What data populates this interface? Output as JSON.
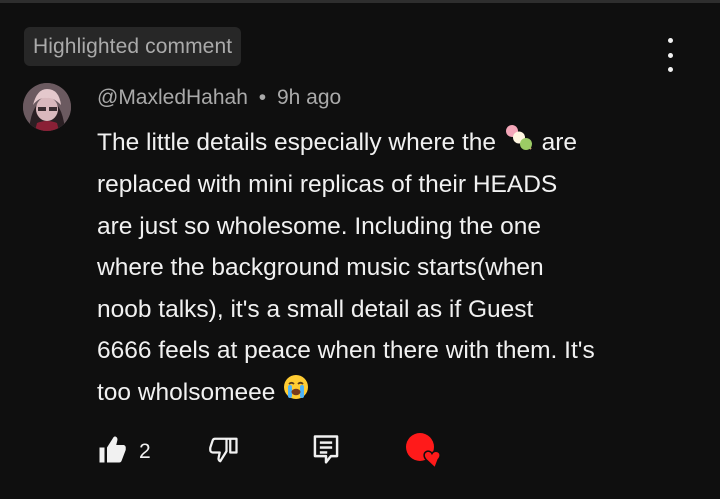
{
  "badge": {
    "label": "Highlighted comment"
  },
  "comment": {
    "author": "@MaxledHahah",
    "separator": "•",
    "time": "9h ago",
    "lines": {
      "l1a": "The little details especially where the ",
      "l1b": " are",
      "l2": "replaced with mini replicas of their HEADS",
      "l3": "are just so wholesome. Including the one",
      "l4": "where the background music starts(when",
      "l5": "noob talks), it's a small detail as if Guest",
      "l6": "6666 feels at peace when there with them. It's",
      "l7": "too wholsomeee "
    },
    "emojis": [
      "dango-emoji",
      "loudly-crying-face-emoji"
    ]
  },
  "actions": {
    "like_count": "2",
    "icons": [
      "thumbs-up-icon",
      "thumbs-down-icon",
      "reply-icon",
      "creator-heart-icon"
    ]
  },
  "colors": {
    "background": "#0f0f0f",
    "text": "#f1f1f1",
    "muted": "#aaaaaa",
    "badge_bg": "#272727",
    "heart": "#ff0000"
  }
}
